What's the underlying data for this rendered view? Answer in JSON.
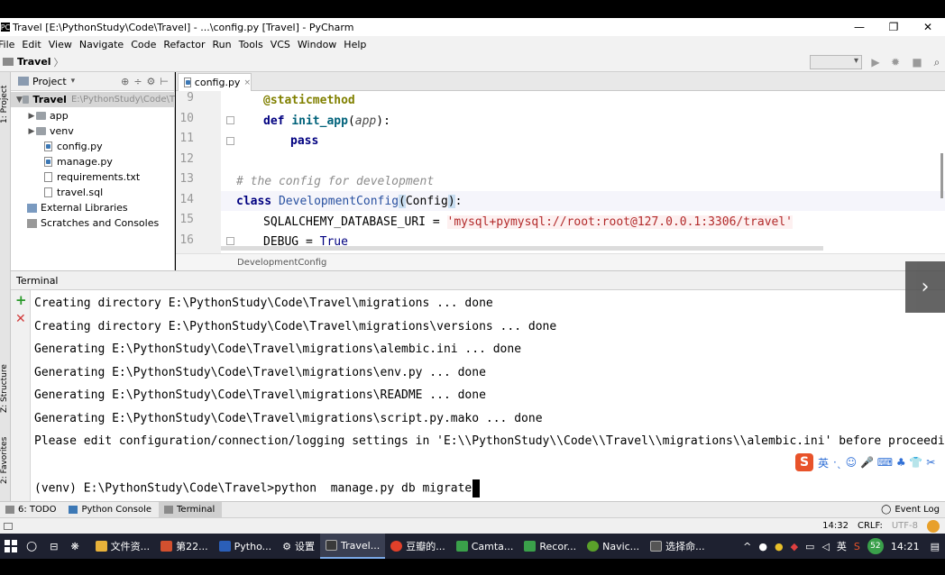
{
  "window": {
    "title": "Travel [E:\\PythonStudy\\Code\\Travel] - ...\\config.py [Travel] - PyCharm",
    "app_icon": "PC",
    "controls": [
      "—",
      "❐",
      "✕"
    ]
  },
  "menu": [
    "File",
    "Edit",
    "View",
    "Navigate",
    "Code",
    "Refactor",
    "Run",
    "Tools",
    "VCS",
    "Window",
    "Help"
  ],
  "nav": {
    "project": "Travel",
    "arrow": "〉"
  },
  "left_strip": {
    "project_tab": "1: Project",
    "structure_tab": "Z: Structure",
    "favorites_tab": "2: Favorites"
  },
  "project_panel": {
    "header": "Project",
    "header_arrow": "▾",
    "tools": [
      "⊕",
      "÷",
      "⚙",
      "⊢"
    ],
    "tree": [
      {
        "label": "Travel",
        "path": "E:\\PythonStudy\\Code\\T",
        "kind": "root"
      },
      {
        "label": "app",
        "kind": "folder"
      },
      {
        "label": "venv",
        "kind": "folder"
      },
      {
        "label": "config.py",
        "kind": "py"
      },
      {
        "label": "manage.py",
        "kind": "py"
      },
      {
        "label": "requirements.txt",
        "kind": "file"
      },
      {
        "label": "travel.sql",
        "kind": "file"
      },
      {
        "label": "External Libraries",
        "kind": "lib"
      },
      {
        "label": "Scratches and Consoles",
        "kind": "scratch"
      }
    ]
  },
  "editor": {
    "tab": "config.py",
    "tab_close": "×",
    "line_numbers": [
      "9",
      "10",
      "11",
      "12",
      "13",
      "14",
      "15",
      "16"
    ],
    "lines": {
      "l9": {
        "decorator": "@staticmethod"
      },
      "l10": {
        "kw": "def",
        "fn": "init_app",
        "open": "(",
        "param": "app",
        "close": "):"
      },
      "l11": {
        "kw": "pass"
      },
      "l13": {
        "comment": "# the config for development"
      },
      "l14": {
        "kw": "class",
        "cls": "DevelopmentConfig",
        "p1": "(",
        "base": "Config",
        "p2": ")",
        "colon": ":"
      },
      "l15": {
        "name": "SQLALCHEMY_DATABASE_URI = ",
        "str": "'mysql+pymysql://root:root@127.0.0.1:3306/travel'"
      },
      "l16": {
        "name": "DEBUG = ",
        "bool": "True"
      }
    },
    "breadcrumb": "DevelopmentConfig"
  },
  "terminal": {
    "title": "Terminal",
    "lines": [
      "Creating directory E:\\PythonStudy\\Code\\Travel\\migrations ... done",
      "Creating directory E:\\PythonStudy\\Code\\Travel\\migrations\\versions ... done",
      "Generating E:\\PythonStudy\\Code\\Travel\\migrations\\alembic.ini ... done",
      "Generating E:\\PythonStudy\\Code\\Travel\\migrations\\env.py ... done",
      "Generating E:\\PythonStudy\\Code\\Travel\\migrations\\README ... done",
      "Generating E:\\PythonStudy\\Code\\Travel\\migrations\\script.py.mako ... done",
      "Please edit configuration/connection/logging settings in 'E:\\\\PythonStudy\\\\Code\\\\Travel\\\\migrations\\\\alembic.ini' before proceeding."
    ],
    "prompt": "(venv) E:\\PythonStudy\\Code\\Travel>python  manage.py db migrate",
    "overlay_glyph": "›"
  },
  "ime_bar": {
    "logo": "S",
    "lang": "英",
    "glyphs": "·ˎ ☺ 🎤 ⌨ ♣ 👕 ✂"
  },
  "bottom_tabs": [
    "6: TODO",
    "Python Console",
    "Terminal"
  ],
  "event_log": "Event Log",
  "status": {
    "position": "14:32",
    "line_sep": "CRLF:",
    "encoding": "UTF-8"
  },
  "taskbar": {
    "apps": [
      {
        "label": "文件资...",
        "color": "#e8b23a"
      },
      {
        "label": "第22...",
        "color": "#d2502f"
      },
      {
        "label": "Pytho...",
        "color": "#2b5fb8"
      },
      {
        "label": "设置",
        "color": "#ffffff"
      },
      {
        "label": "Travel...",
        "color": "#3a3a3a"
      },
      {
        "label": "豆瓣的...",
        "color": "#e0402a"
      },
      {
        "label": "Camta...",
        "color": "#3aa04a"
      },
      {
        "label": "Recor...",
        "color": "#3aa04a"
      },
      {
        "label": "Navic...",
        "color": "#5aa02a"
      },
      {
        "label": "选择命...",
        "color": "#555555"
      }
    ],
    "tray_lang": "英",
    "badge": "52",
    "clock": "14:21"
  }
}
